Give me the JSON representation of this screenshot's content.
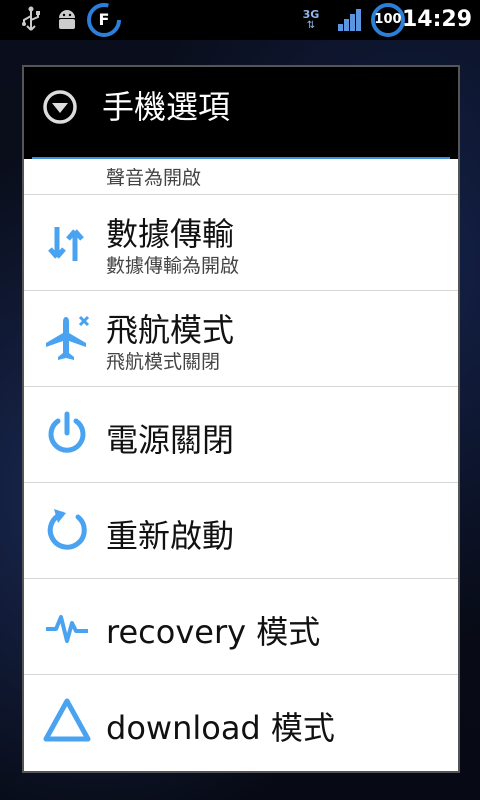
{
  "status_bar": {
    "icons": [
      "usb-icon",
      "android-debug-icon",
      "f-badge-icon",
      "3g-data-icon",
      "signal-icon",
      "battery-100-icon"
    ],
    "battery_text": "100",
    "badge_text": "F",
    "network_text": "3G",
    "time": "14:29"
  },
  "dialog": {
    "title": "手機選項",
    "partial_item_sub": "聲音為開啟",
    "items": [
      {
        "label": "數據傳輸",
        "sub": "數據傳輸為開啟",
        "icon": "data-transfer-icon"
      },
      {
        "label": "飛航模式",
        "sub": "飛航模式關閉",
        "icon": "airplane-icon"
      },
      {
        "label": "電源關閉",
        "icon": "power-icon"
      },
      {
        "label": "重新啟動",
        "icon": "restart-icon"
      },
      {
        "label": "recovery 模式",
        "icon": "pulse-icon"
      },
      {
        "label": "download 模式",
        "icon": "triangle-icon"
      }
    ]
  },
  "colors": {
    "accent": "#3a8ee6",
    "icon_blue": "#4aa3f0"
  }
}
